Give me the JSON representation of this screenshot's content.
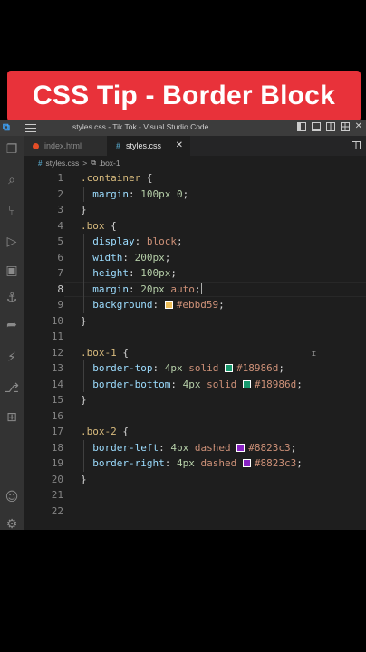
{
  "banner": {
    "title": "CSS Tip - Border Block"
  },
  "titlebar": {
    "title": "styles.css - Tik Tok - Visual Studio Code",
    "close": "✕"
  },
  "tabs": [
    {
      "label": "index.html",
      "active": false
    },
    {
      "label": "styles.css",
      "active": true,
      "close": "✕"
    }
  ],
  "breadcrumb": {
    "file": "styles.css",
    "separator": ">",
    "symbol": ".box-1"
  },
  "lines": [
    {
      "n": "1"
    },
    {
      "n": "2"
    },
    {
      "n": "3"
    },
    {
      "n": "4"
    },
    {
      "n": "5"
    },
    {
      "n": "6"
    },
    {
      "n": "7"
    },
    {
      "n": "8"
    },
    {
      "n": "9"
    },
    {
      "n": "10"
    },
    {
      "n": "11"
    },
    {
      "n": "12"
    },
    {
      "n": "13"
    },
    {
      "n": "14"
    },
    {
      "n": "15"
    },
    {
      "n": "16"
    },
    {
      "n": "17"
    },
    {
      "n": "18"
    },
    {
      "n": "19"
    },
    {
      "n": "20"
    },
    {
      "n": "21"
    },
    {
      "n": "22"
    }
  ],
  "code": {
    "l1": {
      "sel": ".container",
      "brace": " {"
    },
    "l2": {
      "prop": "margin",
      "colon": ": ",
      "num": "100px 0",
      "end": ";"
    },
    "l3": {
      "brace": "}"
    },
    "l4": {
      "sel": ".box",
      "brace": " {"
    },
    "l5": {
      "prop": "display",
      "colon": ": ",
      "val": "block",
      "end": ";"
    },
    "l6": {
      "prop": "width",
      "colon": ": ",
      "num": "200px",
      "end": ";"
    },
    "l7": {
      "prop": "height",
      "colon": ": ",
      "num": "100px",
      "end": ";"
    },
    "l8": {
      "prop": "margin",
      "colon": ": ",
      "num": "20px",
      "val": " auto",
      "end": ";"
    },
    "l9": {
      "prop": "background",
      "colon": ": ",
      "val": "#ebbd59",
      "end": ";",
      "swatch": "#ebbd59"
    },
    "l10": {
      "brace": "}"
    },
    "l12": {
      "sel": ".box-1",
      "brace": " {"
    },
    "l13": {
      "prop": "border-top",
      "colon": ": ",
      "num": "4px",
      "val": " solid ",
      "color": "#18986d",
      "end": ";",
      "swatch": "#18986d"
    },
    "l14": {
      "prop": "border-bottom",
      "colon": ": ",
      "num": "4px",
      "val": " solid ",
      "color": "#18986d",
      "end": ";",
      "swatch": "#18986d"
    },
    "l15": {
      "brace": "}"
    },
    "l17": {
      "sel": ".box-2",
      "brace": " {"
    },
    "l18": {
      "prop": "border-left",
      "colon": ": ",
      "num": "4px",
      "val": " dashed ",
      "color": "#8823c3",
      "end": ";",
      "swatch": "#8823c3"
    },
    "l19": {
      "prop": "border-right",
      "colon": ": ",
      "num": "4px",
      "val": " dashed ",
      "color": "#8823c3",
      "end": ";",
      "swatch": "#8823c3"
    },
    "l20": {
      "brace": "}"
    }
  },
  "colors": {
    "banner": "#e8323a",
    "editor_bg": "#1e1e1e",
    "accent": "#3ea6ff"
  },
  "icons": [
    "vscode-logo-icon",
    "menu-icon",
    "explorer-icon",
    "search-icon",
    "source-control-icon",
    "run-debug-icon",
    "remote-explorer-icon",
    "docker-icon",
    "live-share-icon",
    "thunder-client-icon",
    "git-graph-icon",
    "extensions-icon",
    "account-icon",
    "settings-gear-icon"
  ]
}
